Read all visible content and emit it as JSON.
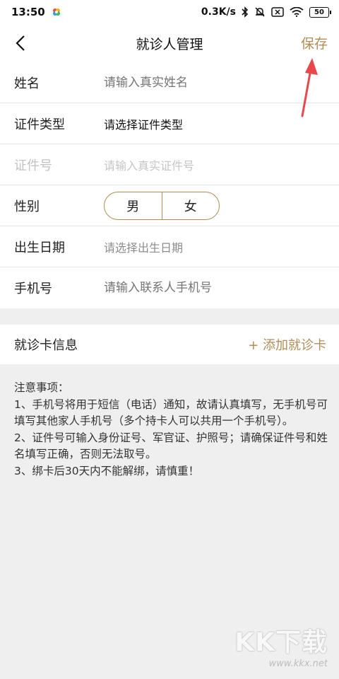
{
  "status_bar": {
    "time": "13:50",
    "net_speed": "0.3K/s",
    "battery": "50"
  },
  "nav": {
    "title": "就诊人管理",
    "save_label": "保存"
  },
  "form": {
    "name": {
      "label": "姓名",
      "placeholder": "请输入真实姓名"
    },
    "id_type": {
      "label": "证件类型",
      "placeholder": "请选择证件类型"
    },
    "id_number": {
      "label": "证件号",
      "placeholder": "请输入真实证件号"
    },
    "gender": {
      "label": "性别",
      "options": [
        "男",
        "女"
      ]
    },
    "birth_date": {
      "label": "出生日期",
      "placeholder": "请选择出生日期"
    },
    "phone": {
      "label": "手机号",
      "placeholder": "请输入联系人手机号"
    }
  },
  "card_section": {
    "label": "就诊卡信息",
    "add_label": "+ 添加就诊卡"
  },
  "notes": {
    "title": "注意事项：",
    "items": [
      "1、手机号将用于短信（电话）通知，故请认真填写，无手机号可填写其他家人手机号（多个持卡人可以共用一个手机号）。",
      "2、证件号可输入身份证号、军官证、护照号；请确保证件号和姓名填写正确，否则无法取号。",
      "3、绑卡后30天内不能解绑，请慎重！"
    ]
  },
  "watermark": {
    "logo": "KK下载",
    "url": "www.kkx.net"
  },
  "colors": {
    "accent": "#b08d57",
    "arrow": "#e8474c",
    "background": "#efefef"
  }
}
